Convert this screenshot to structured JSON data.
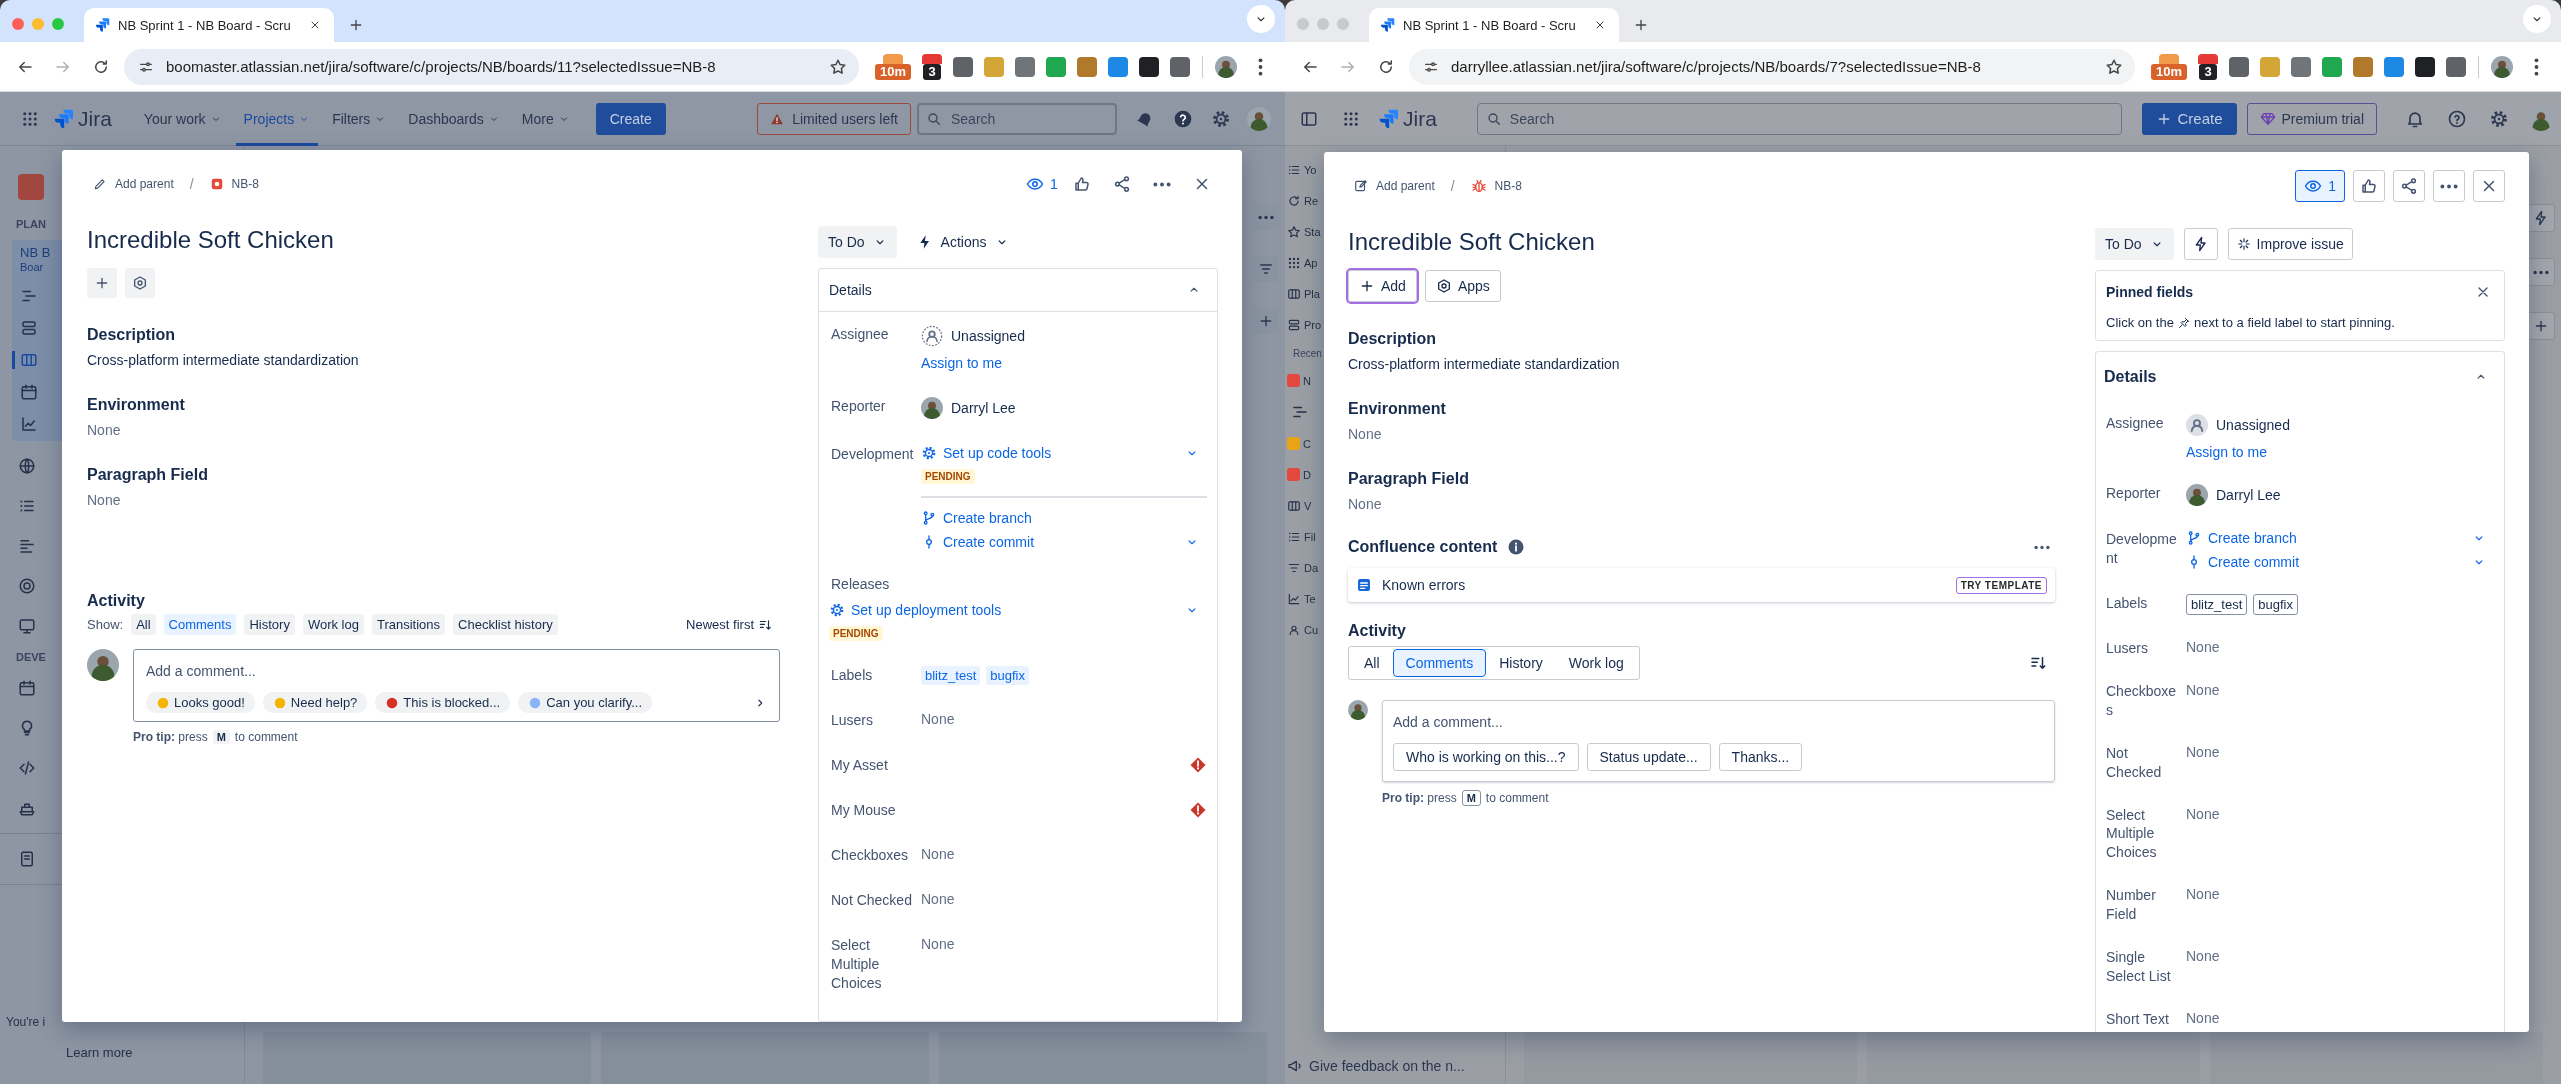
{
  "windows": [
    {
      "kind": "classic",
      "focused": true,
      "tab": {
        "title": "NB Sprint 1 - NB Board - Scru"
      },
      "url": "boomaster.atlassian.net/jira/software/c/projects/NB/boards/11?selectedIssue=NB-8",
      "extensions": [
        {
          "color": "#f2994a",
          "badge": "10m"
        },
        {
          "color": "#e53935",
          "badge": "3"
        },
        {
          "color": "#5f6368"
        },
        {
          "color": "#d4a537"
        },
        {
          "color": "#70757a"
        },
        {
          "color": "#1fa84f"
        },
        {
          "color": "#b07a2a"
        },
        {
          "color": "#1e88e5"
        },
        {
          "color": "#202124"
        },
        {
          "color": "#5f6368"
        }
      ],
      "nav": {
        "brand": "Jira",
        "items": [
          {
            "label": "Your work",
            "selected": false
          },
          {
            "label": "Projects",
            "selected": true
          },
          {
            "label": "Filters",
            "selected": false
          },
          {
            "label": "Dashboards",
            "selected": false
          },
          {
            "label": "More",
            "selected": false
          }
        ],
        "create": "Create",
        "notice": "Limited users left",
        "search": {
          "placeholder": "Search"
        }
      },
      "sidebar": [
        {
          "kind": "project"
        },
        {
          "kind": "heading",
          "text": "PLAN"
        },
        {
          "kind": "group",
          "text": "NB B",
          "sub": "Boar",
          "children": [
            {
              "selected": false
            },
            {
              "selected": false
            },
            {
              "selected": true
            },
            {
              "selected": false
            },
            {
              "selected": false
            }
          ]
        },
        {
          "kind": "icon"
        },
        {
          "kind": "icon"
        },
        {
          "kind": "icon"
        },
        {
          "kind": "icon"
        },
        {
          "kind": "icon"
        },
        {
          "kind": "heading",
          "text": "DEVE"
        },
        {
          "kind": "icon"
        },
        {
          "kind": "icon"
        },
        {
          "kind": "icon"
        },
        {
          "kind": "icon"
        },
        {
          "kind": "divider"
        },
        {
          "kind": "icon"
        },
        {
          "kind": "divider"
        },
        {
          "kind": "footer",
          "text": "You're i"
        },
        {
          "kind": "link",
          "text": "Learn more"
        }
      ],
      "issue": {
        "parent": "Add parent",
        "separator": "/",
        "key": "NB-8",
        "watchers": "1",
        "title": "Incredible Soft Chicken",
        "quick_actions": [
          {
            "focused": false
          },
          {
            "focused": false
          }
        ],
        "sections": [
          {
            "heading": "Description",
            "text": "Cross-platform intermediate standardization",
            "empty": false
          },
          {
            "heading": "Environment",
            "text": "None",
            "empty": true
          },
          {
            "heading": "Paragraph Field",
            "text": "None",
            "empty": true
          }
        ],
        "activity": {
          "heading": "Activity",
          "show_label": "Show:",
          "filters": [
            {
              "label": "All",
              "selected": false
            },
            {
              "label": "Comments",
              "selected": true
            },
            {
              "label": "History",
              "selected": false
            },
            {
              "label": "Work log",
              "selected": false
            },
            {
              "label": "Transitions",
              "selected": false
            },
            {
              "label": "Checklist history",
              "selected": false
            }
          ],
          "sort": "Newest first"
        },
        "comment": {
          "placeholder": "Add a comment...",
          "suggestions": [
            "Looks good!",
            "Need help?",
            "This is blocked...",
            "Can you clarify..."
          ],
          "tip_lead": "**Pro tip:** press",
          "tip_key": "M",
          "tip_tail": "to comment"
        },
        "status": "To Do",
        "actions": "Actions",
        "details": {
          "title": "Details",
          "expanded": true,
          "fields": [
            {
              "kind": "user",
              "label": "Assignee",
              "value": "Unassigned",
              "assigned": false,
              "link": "Assign to me"
            },
            {
              "kind": "user",
              "label": "Reporter",
              "value": "Darryl Lee",
              "assigned": true
            },
            {
              "kind": "dev",
              "label": "Development",
              "items": [
                {
                  "kind": "setup",
                  "text": "Set up code tools",
                  "caret": true,
                  "badge": "PENDING",
                  "separated": false
                },
                {
                  "kind": "branch",
                  "text": "Create branch",
                  "caret": false,
                  "separated": true
                },
                {
                  "kind": "commit",
                  "text": "Create commit",
                  "caret": true,
                  "separated": false
                }
              ]
            },
            {
              "kind": "block",
              "label": "Releases",
              "items": [
                {
                  "kind": "setup",
                  "text": "Set up deployment tools",
                  "caret": true,
                  "badge": "PENDING",
                  "separated": false
                }
              ]
            },
            {
              "kind": "labels",
              "label": "Labels",
              "labels": [
                "blitz_test",
                "bugfix"
              ],
              "outlined": false
            },
            {
              "kind": "text",
              "label": "Lusers",
              "value": "None"
            },
            {
              "kind": "alert",
              "label": "My Asset"
            },
            {
              "kind": "alert",
              "label": "My Mouse"
            },
            {
              "kind": "text",
              "label": "Checkboxes",
              "value": "None"
            },
            {
              "kind": "text",
              "label": "Not Checked",
              "value": "None"
            },
            {
              "kind": "text",
              "label": "Select Multiple Choices",
              "value": "None"
            }
          ]
        }
      }
    },
    {
      "kind": "new",
      "focused": false,
      "tab": {
        "title": "NB Sprint 1 - NB Board - Scru"
      },
      "url": "darryllee.atlassian.net/jira/software/c/projects/NB/boards/7?selectedIssue=NB-8",
      "extensions": [
        {
          "color": "#f2994a",
          "badge": "10m"
        },
        {
          "color": "#e53935",
          "badge": "3"
        },
        {
          "color": "#5f6368"
        },
        {
          "color": "#d4a537"
        },
        {
          "color": "#70757a"
        },
        {
          "color": "#1fa84f"
        },
        {
          "color": "#b07a2a"
        },
        {
          "color": "#1e88e5"
        },
        {
          "color": "#202124"
        },
        {
          "color": "#5f6368"
        }
      ],
      "nav": {
        "brand": "Jira",
        "create": "Create",
        "premium": "Premium trial",
        "search": {
          "placeholder": "Search"
        }
      },
      "sidebar": [
        {
          "kind": "item",
          "text": "Yo"
        },
        {
          "kind": "item",
          "text": "Re"
        },
        {
          "kind": "item",
          "text": "Sta"
        },
        {
          "kind": "item",
          "text": "Ap"
        },
        {
          "kind": "item",
          "text": "Pla"
        },
        {
          "kind": "item",
          "text": "Pro"
        },
        {
          "kind": "heading",
          "text": "Recen"
        },
        {
          "kind": "recent",
          "text": "N",
          "color": "#e2483d"
        },
        {
          "kind": "icon"
        },
        {
          "kind": "recent",
          "text": "C",
          "color": "#e8a317"
        },
        {
          "kind": "recent",
          "text": "D",
          "color": "#e2483d"
        },
        {
          "kind": "item",
          "text": "V"
        },
        {
          "kind": "item",
          "text": "Fil"
        },
        {
          "kind": "item",
          "text": "Da"
        },
        {
          "kind": "item",
          "text": "Te"
        },
        {
          "kind": "item",
          "text": "Cu"
        },
        {
          "kind": "feedback",
          "text": "Give feedback on the n..."
        }
      ],
      "issue": {
        "parent": "Add parent",
        "separator": "/",
        "key": "NB-8",
        "watchers": "1",
        "title": "Incredible Soft Chicken",
        "quick_actions": [
          {
            "label": "Add",
            "focused": true
          },
          {
            "label": "Apps",
            "focused": false
          }
        ],
        "sections": [
          {
            "heading": "Description",
            "text": "Cross-platform intermediate standardization",
            "empty": false
          },
          {
            "heading": "Environment",
            "text": "None",
            "empty": true
          },
          {
            "heading": "Paragraph Field",
            "text": "None",
            "empty": true
          }
        ],
        "confluence": {
          "heading": "Confluence content",
          "items": [
            {
              "title": "Known errors",
              "badge": "TRY TEMPLATE"
            }
          ]
        },
        "activity": {
          "heading": "Activity",
          "filters": [
            {
              "label": "All",
              "selected": false
            },
            {
              "label": "Comments",
              "selected": true
            },
            {
              "label": "History",
              "selected": false
            },
            {
              "label": "Work log",
              "selected": false
            }
          ]
        },
        "comment": {
          "placeholder": "Add a comment...",
          "suggestions": [
            "Who is working on this...?",
            "Status update...",
            "Thanks..."
          ],
          "tip_lead": "**Pro tip:** press",
          "tip_key": "M",
          "tip_tail": "to comment"
        },
        "status": "To Do",
        "improve": "Improve issue",
        "pinned": {
          "title": "Pinned fields",
          "lead": "Click on the",
          "tail": "next to a field label to start pinning."
        },
        "details": {
          "title": "Details",
          "expanded": true,
          "fields": [
            {
              "kind": "user",
              "label": "Assignee",
              "value": "Unassigned",
              "assigned": false,
              "link": "Assign to me"
            },
            {
              "kind": "user",
              "label": "Reporter",
              "value": "Darryl Lee",
              "assigned": true
            },
            {
              "kind": "dev",
              "label": "Development",
              "items": [
                {
                  "kind": "branch",
                  "text": "Create branch",
                  "caret": true,
                  "separated": false
                },
                {
                  "kind": "commit",
                  "text": "Create commit",
                  "caret": true,
                  "separated": false
                }
              ]
            },
            {
              "kind": "labels",
              "label": "Labels",
              "labels": [
                "blitz_test",
                "bugfix"
              ],
              "outlined": true
            },
            {
              "kind": "text",
              "label": "Lusers",
              "value": "None"
            },
            {
              "kind": "text",
              "label": "Checkboxes",
              "value": "None"
            },
            {
              "kind": "text",
              "label": "Not Checked",
              "value": "None"
            },
            {
              "kind": "text",
              "label": "Select Multiple Choices",
              "value": "None"
            },
            {
              "kind": "text",
              "label": "Number Field",
              "value": "None"
            },
            {
              "kind": "text",
              "label": "Single Select List",
              "value": "None"
            },
            {
              "kind": "text",
              "label": "Short Text",
              "value": "None"
            }
          ]
        }
      }
    }
  ]
}
